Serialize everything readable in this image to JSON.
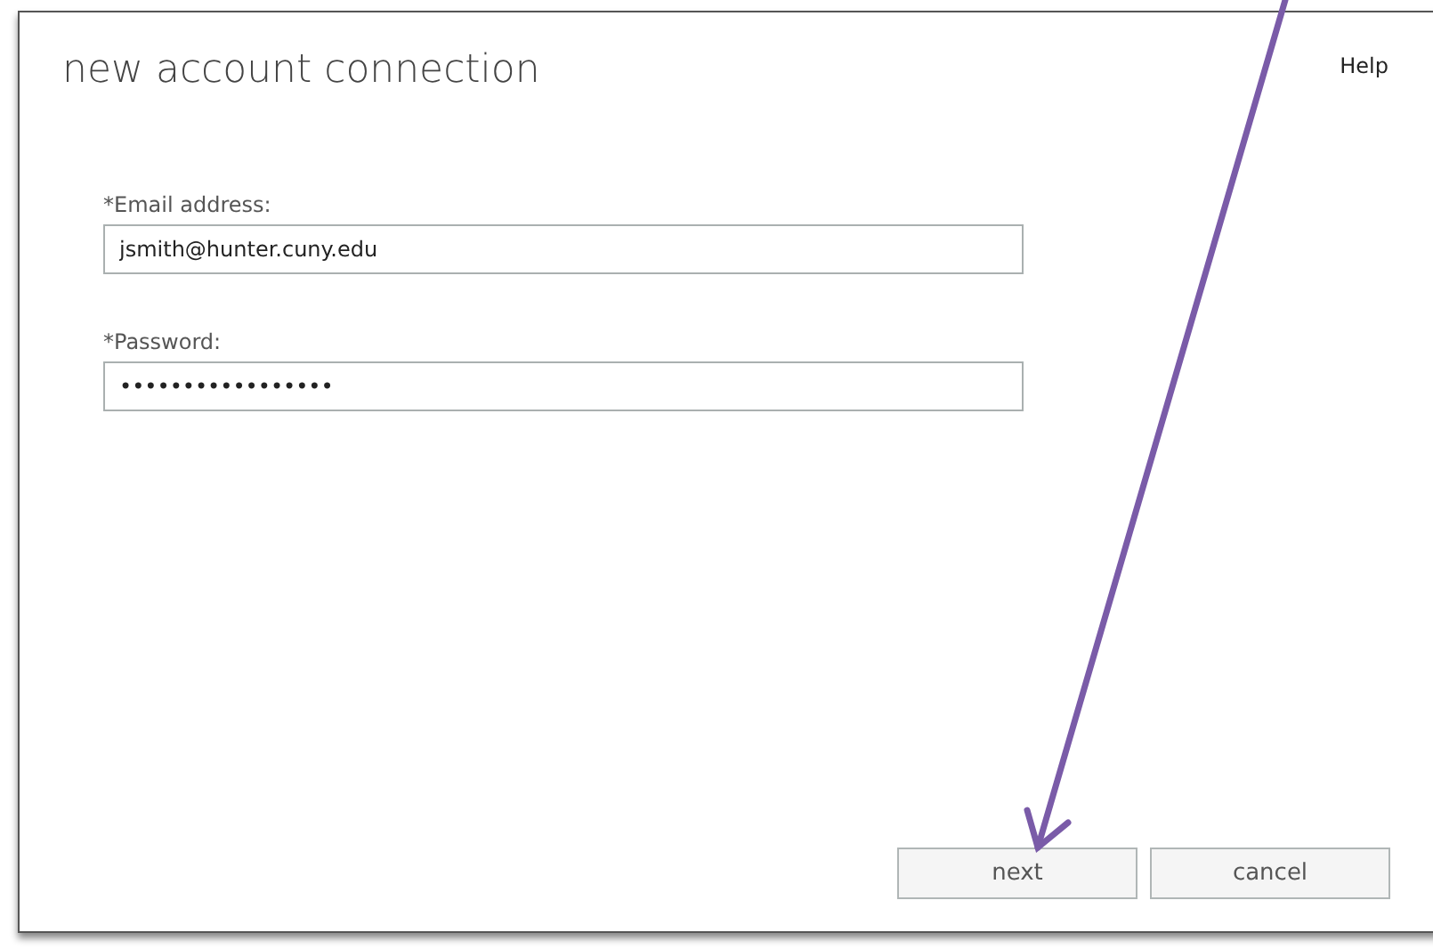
{
  "window": {
    "title": "new account connection",
    "help": "Help"
  },
  "fields": [
    {
      "label": "*Email address:",
      "value": "jsmith@hunter.cuny.edu"
    },
    {
      "label": "*Password:",
      "value": "•••••••••••••••••"
    }
  ],
  "buttons": [
    "next",
    "cancel"
  ]
}
